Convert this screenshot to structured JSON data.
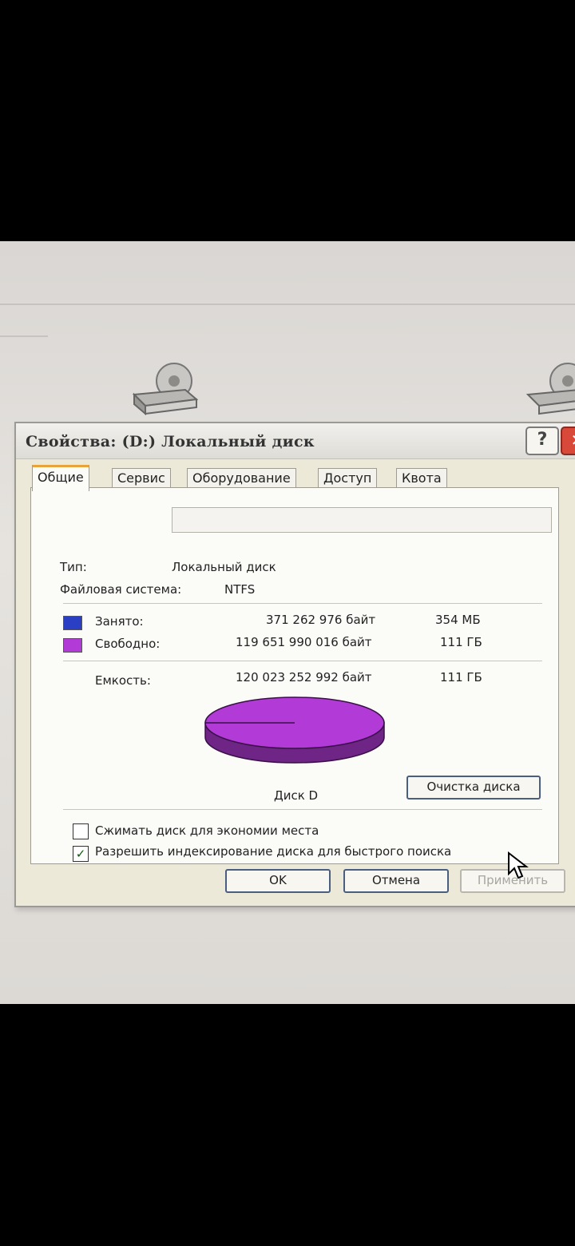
{
  "dialog": {
    "title": "Свойства: (D:) Локальный диск",
    "help_label": "?",
    "close_label": "✕"
  },
  "tabs": [
    {
      "label": "Общие"
    },
    {
      "label": "Сервис"
    },
    {
      "label": "Оборудование"
    },
    {
      "label": "Доступ"
    },
    {
      "label": "Квота"
    }
  ],
  "general": {
    "name_value": "",
    "type_label": "Тип:",
    "type_value": "Локальный диск",
    "fs_label": "Файловая система:",
    "fs_value": "NTFS",
    "used": {
      "label": "Занято:",
      "bytes": "371 262 976 байт",
      "size": "354 МБ",
      "color": "#2b3fc4"
    },
    "free": {
      "label": "Свободно:",
      "bytes": "119 651 990 016 байт",
      "size": "111 ГБ",
      "color": "#b23ad6"
    },
    "capacity": {
      "label": "Емкость:",
      "bytes": "120 023 252 992 байт",
      "size": "111 ГБ"
    },
    "disk_label": "Диск D",
    "cleanup_label": "Очистка диска",
    "used_fraction": 0.0031
  },
  "options": {
    "compress_label": "Сжимать диск для экономии места",
    "compress_checked": false,
    "index_label": "Разрешить индексирование диска для быстрого поиска",
    "index_checked": true
  },
  "footer": {
    "ok_label": "OK",
    "cancel_label": "Отмена",
    "apply_label": "Применить"
  },
  "colors": {
    "accent_tab": "#e8a33a",
    "pie_free": "#b23ad6",
    "pie_used": "#2b3fc4"
  }
}
